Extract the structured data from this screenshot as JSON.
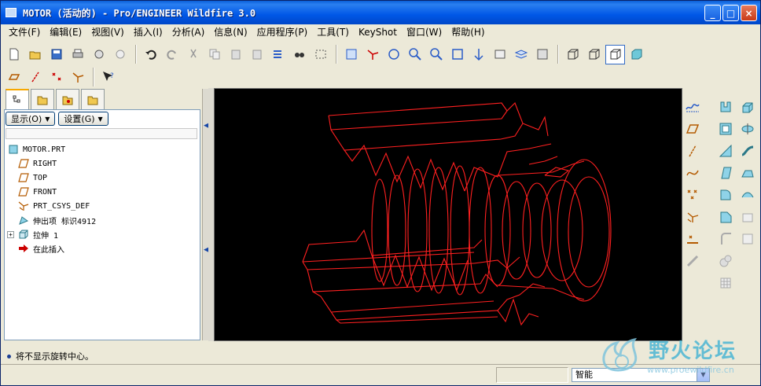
{
  "window": {
    "title": "MOTOR (活动的) - Pro/ENGINEER Wildfire 3.0",
    "controls": {
      "minimize": "_",
      "maximize": "□",
      "close": "×"
    }
  },
  "menubar": {
    "items": [
      {
        "label": "文件(F)"
      },
      {
        "label": "编辑(E)"
      },
      {
        "label": "视图(V)"
      },
      {
        "label": "插入(I)"
      },
      {
        "label": "分析(A)"
      },
      {
        "label": "信息(N)"
      },
      {
        "label": "应用程序(P)"
      },
      {
        "label": "工具(T)"
      },
      {
        "label": "KeyShot"
      },
      {
        "label": "窗口(W)"
      },
      {
        "label": "帮助(H)"
      }
    ]
  },
  "toolbar": {
    "icons": [
      "new-icon",
      "open-icon",
      "save-icon",
      "print-icon",
      "send-icon",
      "mail-icon",
      "undo-icon",
      "redo-icon",
      "cut-icon",
      "copy-icon",
      "paste-icon",
      "paste-special-icon",
      "regenerate-icon",
      "find-icon",
      "select-box-icon",
      "repaint-icon",
      "spin-center-icon",
      "orient-icon",
      "zoom-in-icon",
      "zoom-out-icon",
      "refit-icon",
      "reorient-icon",
      "saved-views-icon",
      "layers-icon",
      "view-manager-icon",
      "wireframe-icon",
      "hidden-line-icon",
      "no-hidden-icon",
      "shading-icon"
    ]
  },
  "datum_toolbar": {
    "icons": [
      "datum-planes-icon",
      "datum-axes-icon",
      "datum-points-icon",
      "coordinate-systems-icon",
      "whats-this-icon"
    ]
  },
  "left_panel": {
    "tabs": [
      "model-tree-tab",
      "folder-browser-tab",
      "favorites-tab",
      "connections-tab"
    ],
    "show_button": "显示(O)",
    "settings_button": "设置(G)",
    "tree": [
      {
        "label": "MOTOR.PRT",
        "icon": "part-icon",
        "level": 0
      },
      {
        "label": "RIGHT",
        "icon": "datum-plane-icon",
        "level": 1
      },
      {
        "label": "TOP",
        "icon": "datum-plane-icon",
        "level": 1
      },
      {
        "label": "FRONT",
        "icon": "datum-plane-icon",
        "level": 1
      },
      {
        "label": "PRT_CSYS_DEF",
        "icon": "csys-icon",
        "level": 1
      },
      {
        "label": "伸出项 标识4912",
        "icon": "protrusion-icon",
        "level": 1
      },
      {
        "label": "拉伸 1",
        "icon": "extrude-icon",
        "level": 1,
        "expandable": true
      },
      {
        "label": "在此插入",
        "icon": "insert-here-arrow-icon",
        "level": 1
      }
    ]
  },
  "status": {
    "message": "将不显示旋转中心。",
    "filter": "智能"
  },
  "watermark": {
    "text": "野火论坛",
    "url": "www.proewildfire.cn"
  },
  "colors": {
    "titlebar": "#0054e3",
    "viewport_bg": "#000000",
    "model_line": "#ff0000"
  }
}
